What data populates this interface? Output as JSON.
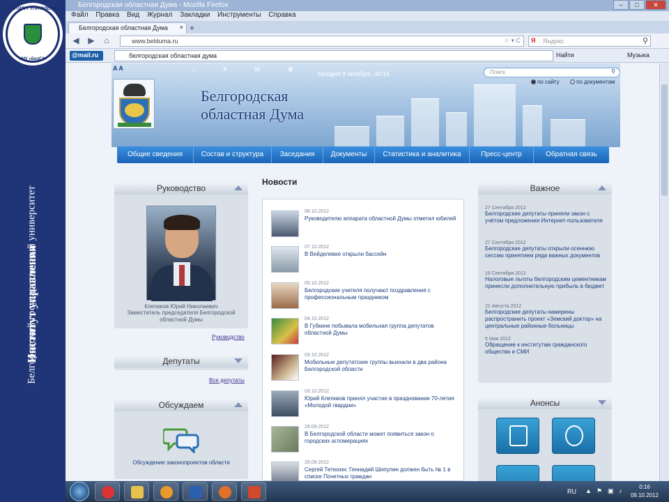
{
  "slide": {
    "side_line1": "Белгородский государственный университет",
    "side_line2": "Институт управления",
    "logo_top": "ИНСТИТУТ УПРАВЛЕНИЯ",
    "logo_bottom": "НИУ «БелГУ»"
  },
  "browser": {
    "title": "Белгородская областная Дума - Mozilla Firefox",
    "menu": [
      "Файл",
      "Правка",
      "Вид",
      "Журнал",
      "Закладки",
      "Инструменты",
      "Справка"
    ],
    "tab_title": "Белгородская областная Дума",
    "url": "www.belduma.ru",
    "search_placeholder": "Яндекс",
    "mailru_label": "@mail.ru",
    "mail_search_value": "белгородская областная дума",
    "find_label": "Найти",
    "music_label": "Музыка"
  },
  "site": {
    "font_size": "A A",
    "date_today": "сегодня 9 октября, 00:16",
    "search_placeholder": "Поиск",
    "radio_site": "по сайту",
    "radio_docs": "по документам",
    "title_line1": "Белгородская",
    "title_line2": "областная Дума",
    "nav": [
      "Общие сведения",
      "Состав и структура",
      "Заседания",
      "Документы",
      "Статистика и аналитика",
      "Пресс-центр",
      "Обратная связь"
    ],
    "left": {
      "rukovod_title": "Руководство",
      "leader_name": "Клепиков Юрий Николаевич",
      "leader_post": "Заместитель председателя Белгородской областной Думы",
      "rukovod_link": "Руководство",
      "deputaty_title": "Депутаты",
      "deputaty_link": "Все депутаты",
      "obsuzhd_title": "Обсуждаем",
      "obsuzhd_text": "Обсуждение законопроектов области"
    },
    "news_title": "Новости",
    "news": [
      {
        "date": "08.10.2012",
        "text": "Руководителю аппарата областной Думы отметил юбилей"
      },
      {
        "date": "07.10.2012",
        "text": "В Вейделевке открыли бассейн"
      },
      {
        "date": "05.10.2012",
        "text": "Белгородские учителя получают поздравления с профессиональным праздником"
      },
      {
        "date": "04.10.2012",
        "text": "В Губкине побывала мобильная группа депутатов областной Думы"
      },
      {
        "date": "03.10.2012",
        "text": "Мобильные депутатские группы выехали в два района Белгородской области"
      },
      {
        "date": "03.10.2012",
        "text": "Юрий Клепиков принял участие в праздновании 70-летия «Молодой гвардии»"
      },
      {
        "date": "29.09.2012",
        "text": "В Белгородской области может появиться закон о городских агломерациях"
      },
      {
        "date": "28.09.2012",
        "text": "Сергей Тетюхин: Геннадий Шипулин должен быть № 1 в списке Почетных граждан"
      }
    ],
    "right": {
      "vazhnoe_title": "Важное",
      "items": [
        {
          "date": "27 Сентября 2012",
          "text": "Белгородские депутаты приняли закон с учётом предложения Интернет-пользователя"
        },
        {
          "date": "27 Сентября 2012",
          "text": "Белгородские депутаты открыли осеннюю сессию принятием ряда важных документов"
        },
        {
          "date": "19 Сентября 2012",
          "text": "Налоговые льготы белгородским цементникам принесли дополнительную прибыль в бюджет"
        },
        {
          "date": "21 Августа 2012",
          "text": "Белгородские депутаты намерены распространить проект «Земский доктор» на центральные районные больницы"
        },
        {
          "date": "5 Мая 2012",
          "text": "Обращение к институтам гражданского общества и СМИ"
        }
      ],
      "anonsy_title": "Анонсы"
    }
  },
  "taskbar": {
    "lang": "RU",
    "time": "0:16",
    "date": "09.10.2012"
  },
  "colors": {
    "nav_blue": "#1a64b6",
    "slide_blue": "#1f3577",
    "link": "#1a3b7a"
  }
}
